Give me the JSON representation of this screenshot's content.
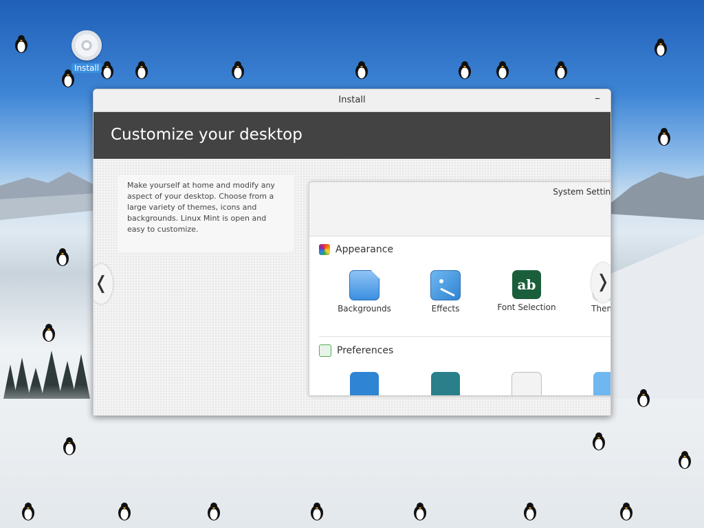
{
  "desktop": {
    "icons": [
      {
        "label": "Install",
        "icon": "disc-icon"
      }
    ]
  },
  "window": {
    "title": "Install",
    "minimize_glyph": "–",
    "banner_title": "Customize your desktop",
    "description": "Make yourself at home and modify any aspect of your desktop. Choose from a large variety of themes, icons and backgrounds. Linux Mint is open and easy to customize.",
    "nav": {
      "prev": "❬",
      "next": "❭"
    }
  },
  "system_settings": {
    "title": "System Settings",
    "sections": [
      {
        "title": "Appearance",
        "icon": "appearance-icon",
        "items": [
          {
            "label": "Backgrounds",
            "icon": "backgrounds-icon"
          },
          {
            "label": "Effects",
            "icon": "effects-icon"
          },
          {
            "label": "Font Selection",
            "icon": "font-selection-icon",
            "glyph": "ab"
          },
          {
            "label": "Themes",
            "icon": "themes-icon"
          }
        ]
      },
      {
        "title": "Preferences",
        "icon": "preferences-icon",
        "items": [
          {
            "icon": "accessibility-icon"
          },
          {
            "icon": "account-icon"
          },
          {
            "icon": "applets-icon"
          },
          {
            "icon": "preferences-item-icon"
          }
        ]
      }
    ]
  },
  "colors": {
    "banner": "#434343",
    "accent_blue": "#3b8fe0",
    "font_icon_green": "#1b5e3c",
    "account_teal": "#2a7f8a"
  }
}
